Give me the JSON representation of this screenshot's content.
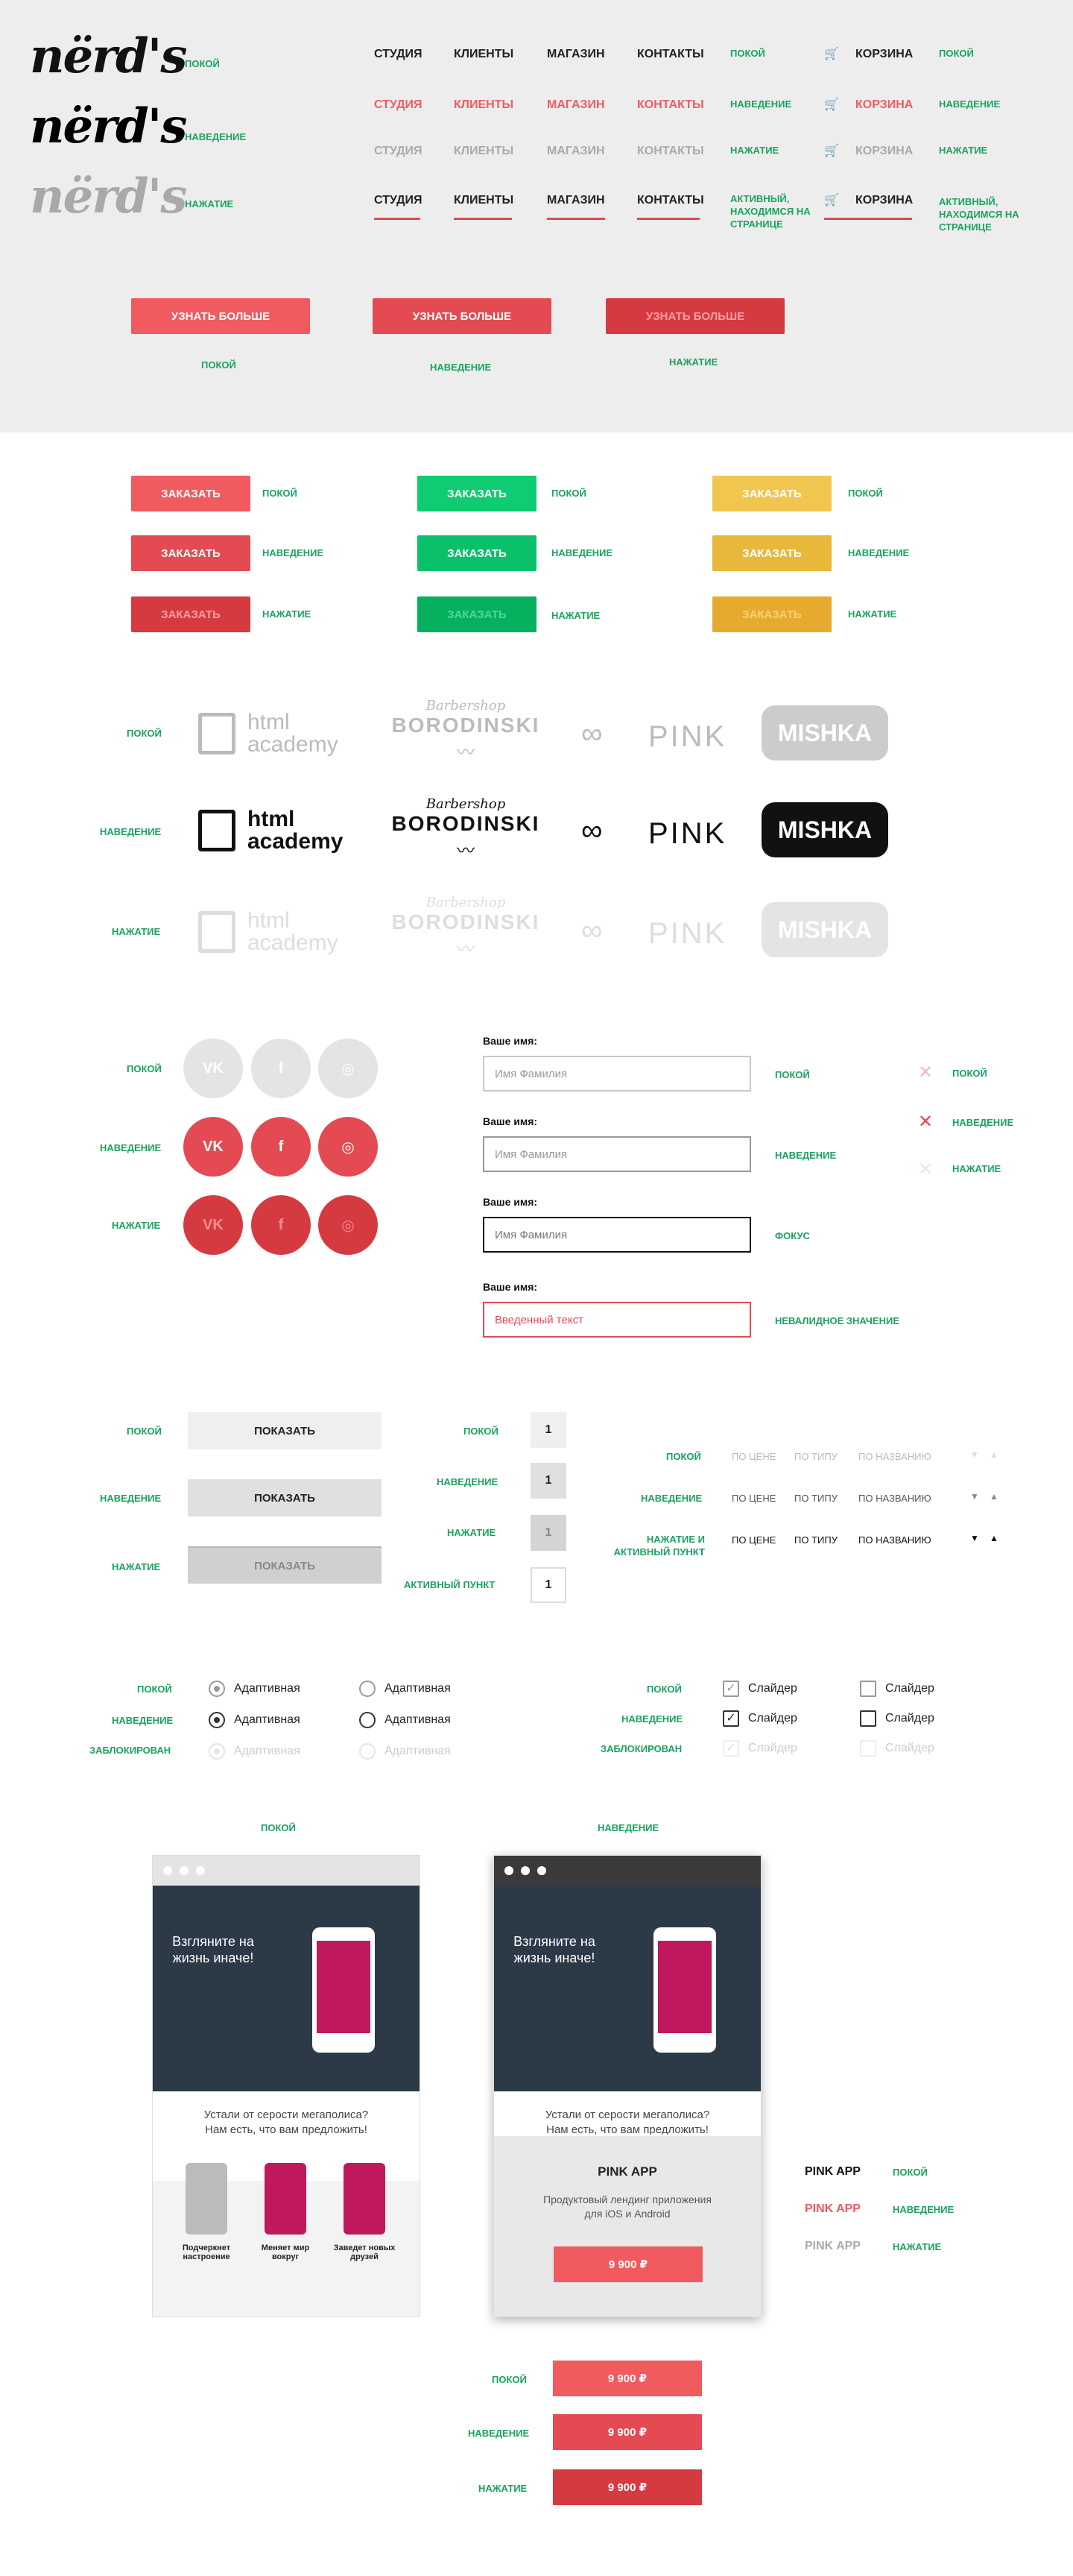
{
  "states": {
    "normal": "ПОКОЙ",
    "hover": "НАВЕДЕНИЕ",
    "active": "НАЖАТИЕ",
    "active_page": "АКТИВНЫЙ, НАХОДИМСЯ НА СТРАНИЦЕ",
    "focus": "ФОКУС",
    "invalid": "НЕВАЛИДНОЕ ЗНАЧЕНИЕ",
    "disabled": "ЗАБЛОКИРОВАН",
    "active_item": "АКТИВНЫЙ ПУНКТ",
    "press_active": "НАЖАТИЕ И АКТИВНЫЙ ПУНКТ"
  },
  "logo": "nërd's",
  "nav": {
    "studio": "СТУДИЯ",
    "clients": "КЛИЕНТЫ",
    "shop": "МАГАЗИН",
    "contacts": "КОНТАКТЫ",
    "cart": "КОРЗИНА"
  },
  "more_button": "УЗНАТЬ БОЛЬШЕ",
  "order_button": "ЗАКАЗАТЬ",
  "partners": {
    "html": "html academy",
    "barber_top": "Barbershop",
    "barber": "BORODINSKI",
    "pink": "PINK",
    "mishka": "MISHKA"
  },
  "social": {
    "vk": "VK",
    "fb": "f",
    "ig": "◎"
  },
  "form": {
    "label": "Ваше имя:",
    "placeholder": "Имя Фамилия",
    "entered": "Введенный текст"
  },
  "show_button": "ПОКАЗАТЬ",
  "pages": [
    "1",
    "1",
    "1",
    "1"
  ],
  "sort": {
    "price": "ПО ЦЕНЕ",
    "type": "ПО ТИПУ",
    "name": "ПО НАЗВАНИЮ"
  },
  "options": {
    "radio": "Адаптивная",
    "check": "Слайдер"
  },
  "card": {
    "title": "PINK APP",
    "desc": "Продуктовый лендинг приложения для iOS и Android",
    "price": "9 900 ₽",
    "tagline1": "Устали от серости мегаполиса?",
    "tagline2": "Нам есть, что вам предложить!",
    "hero": "Взгляните на жизнь иначе!",
    "f1": "Подчеркнет настроение",
    "f2": "Меняет мир вокруг",
    "f3": "Заведет новых друзей"
  },
  "colors": {
    "accent": "#e34a52",
    "green": "#1aa35f"
  }
}
